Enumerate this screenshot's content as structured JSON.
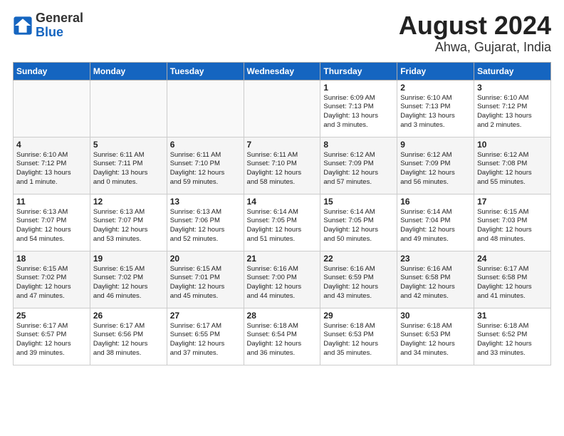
{
  "header": {
    "logo_general": "General",
    "logo_blue": "Blue",
    "title": "August 2024",
    "location": "Ahwa, Gujarat, India"
  },
  "weekdays": [
    "Sunday",
    "Monday",
    "Tuesday",
    "Wednesday",
    "Thursday",
    "Friday",
    "Saturday"
  ],
  "weeks": [
    [
      {
        "day": "",
        "info": ""
      },
      {
        "day": "",
        "info": ""
      },
      {
        "day": "",
        "info": ""
      },
      {
        "day": "",
        "info": ""
      },
      {
        "day": "1",
        "info": "Sunrise: 6:09 AM\nSunset: 7:13 PM\nDaylight: 13 hours\nand 3 minutes."
      },
      {
        "day": "2",
        "info": "Sunrise: 6:10 AM\nSunset: 7:13 PM\nDaylight: 13 hours\nand 3 minutes."
      },
      {
        "day": "3",
        "info": "Sunrise: 6:10 AM\nSunset: 7:12 PM\nDaylight: 13 hours\nand 2 minutes."
      }
    ],
    [
      {
        "day": "4",
        "info": "Sunrise: 6:10 AM\nSunset: 7:12 PM\nDaylight: 13 hours\nand 1 minute."
      },
      {
        "day": "5",
        "info": "Sunrise: 6:11 AM\nSunset: 7:11 PM\nDaylight: 13 hours\nand 0 minutes."
      },
      {
        "day": "6",
        "info": "Sunrise: 6:11 AM\nSunset: 7:10 PM\nDaylight: 12 hours\nand 59 minutes."
      },
      {
        "day": "7",
        "info": "Sunrise: 6:11 AM\nSunset: 7:10 PM\nDaylight: 12 hours\nand 58 minutes."
      },
      {
        "day": "8",
        "info": "Sunrise: 6:12 AM\nSunset: 7:09 PM\nDaylight: 12 hours\nand 57 minutes."
      },
      {
        "day": "9",
        "info": "Sunrise: 6:12 AM\nSunset: 7:09 PM\nDaylight: 12 hours\nand 56 minutes."
      },
      {
        "day": "10",
        "info": "Sunrise: 6:12 AM\nSunset: 7:08 PM\nDaylight: 12 hours\nand 55 minutes."
      }
    ],
    [
      {
        "day": "11",
        "info": "Sunrise: 6:13 AM\nSunset: 7:07 PM\nDaylight: 12 hours\nand 54 minutes."
      },
      {
        "day": "12",
        "info": "Sunrise: 6:13 AM\nSunset: 7:07 PM\nDaylight: 12 hours\nand 53 minutes."
      },
      {
        "day": "13",
        "info": "Sunrise: 6:13 AM\nSunset: 7:06 PM\nDaylight: 12 hours\nand 52 minutes."
      },
      {
        "day": "14",
        "info": "Sunrise: 6:14 AM\nSunset: 7:05 PM\nDaylight: 12 hours\nand 51 minutes."
      },
      {
        "day": "15",
        "info": "Sunrise: 6:14 AM\nSunset: 7:05 PM\nDaylight: 12 hours\nand 50 minutes."
      },
      {
        "day": "16",
        "info": "Sunrise: 6:14 AM\nSunset: 7:04 PM\nDaylight: 12 hours\nand 49 minutes."
      },
      {
        "day": "17",
        "info": "Sunrise: 6:15 AM\nSunset: 7:03 PM\nDaylight: 12 hours\nand 48 minutes."
      }
    ],
    [
      {
        "day": "18",
        "info": "Sunrise: 6:15 AM\nSunset: 7:02 PM\nDaylight: 12 hours\nand 47 minutes."
      },
      {
        "day": "19",
        "info": "Sunrise: 6:15 AM\nSunset: 7:02 PM\nDaylight: 12 hours\nand 46 minutes."
      },
      {
        "day": "20",
        "info": "Sunrise: 6:15 AM\nSunset: 7:01 PM\nDaylight: 12 hours\nand 45 minutes."
      },
      {
        "day": "21",
        "info": "Sunrise: 6:16 AM\nSunset: 7:00 PM\nDaylight: 12 hours\nand 44 minutes."
      },
      {
        "day": "22",
        "info": "Sunrise: 6:16 AM\nSunset: 6:59 PM\nDaylight: 12 hours\nand 43 minutes."
      },
      {
        "day": "23",
        "info": "Sunrise: 6:16 AM\nSunset: 6:58 PM\nDaylight: 12 hours\nand 42 minutes."
      },
      {
        "day": "24",
        "info": "Sunrise: 6:17 AM\nSunset: 6:58 PM\nDaylight: 12 hours\nand 41 minutes."
      }
    ],
    [
      {
        "day": "25",
        "info": "Sunrise: 6:17 AM\nSunset: 6:57 PM\nDaylight: 12 hours\nand 39 minutes."
      },
      {
        "day": "26",
        "info": "Sunrise: 6:17 AM\nSunset: 6:56 PM\nDaylight: 12 hours\nand 38 minutes."
      },
      {
        "day": "27",
        "info": "Sunrise: 6:17 AM\nSunset: 6:55 PM\nDaylight: 12 hours\nand 37 minutes."
      },
      {
        "day": "28",
        "info": "Sunrise: 6:18 AM\nSunset: 6:54 PM\nDaylight: 12 hours\nand 36 minutes."
      },
      {
        "day": "29",
        "info": "Sunrise: 6:18 AM\nSunset: 6:53 PM\nDaylight: 12 hours\nand 35 minutes."
      },
      {
        "day": "30",
        "info": "Sunrise: 6:18 AM\nSunset: 6:53 PM\nDaylight: 12 hours\nand 34 minutes."
      },
      {
        "day": "31",
        "info": "Sunrise: 6:18 AM\nSunset: 6:52 PM\nDaylight: 12 hours\nand 33 minutes."
      }
    ]
  ]
}
